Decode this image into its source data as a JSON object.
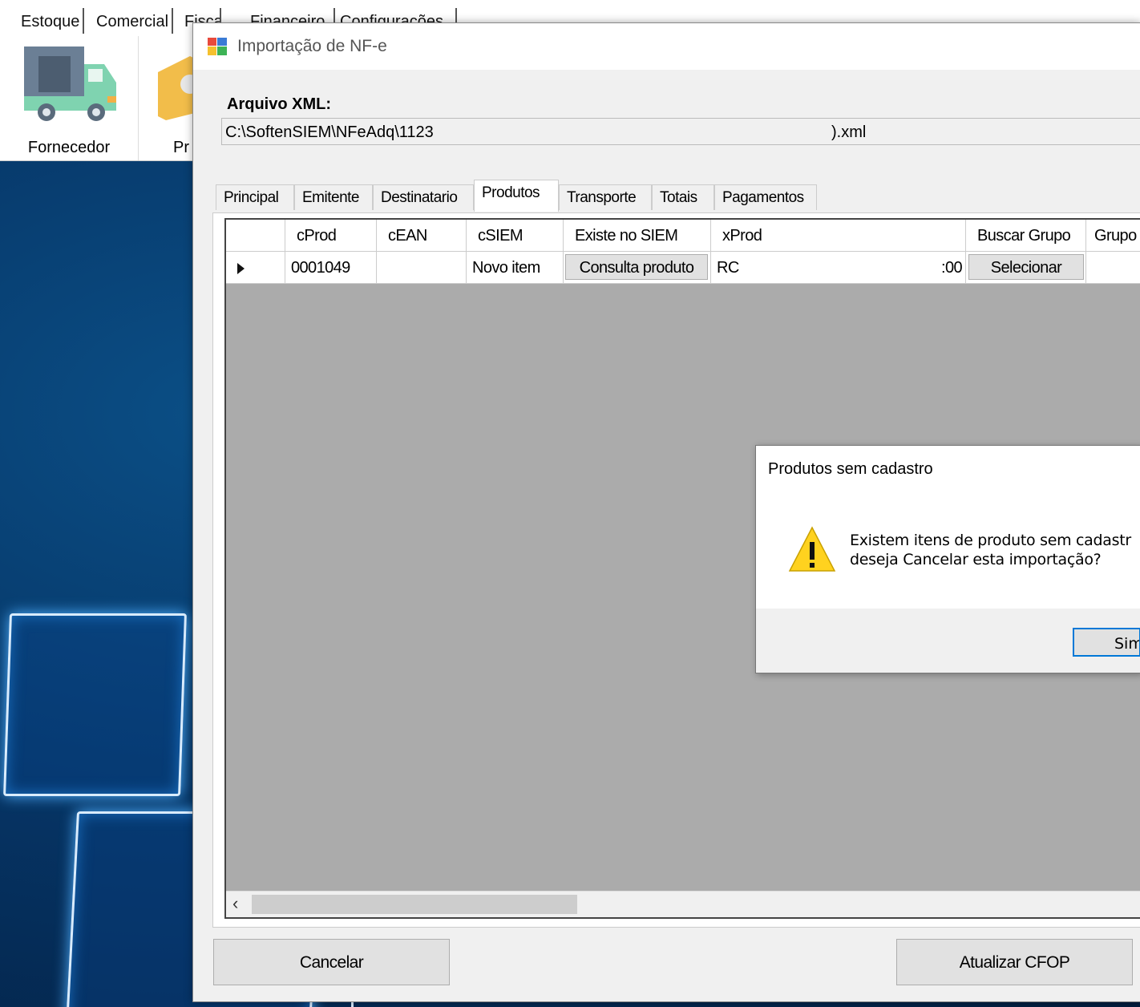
{
  "menubar": {
    "tabs": [
      "Estoque",
      "Comercial",
      "Fiscal",
      "Financeiro",
      "Configurações"
    ]
  },
  "ribbon": {
    "items": [
      {
        "label": "Fornecedor",
        "icon": "truck-icon"
      },
      {
        "label": "Pr",
        "icon": "box-icon"
      }
    ]
  },
  "window": {
    "title": "Importação de NF-e",
    "icon": "app-icon"
  },
  "xml": {
    "label": "Arquivo XML:",
    "path": "C:\\SoftenSIEM\\NFeAdq\\1123",
    "suffix": ").xml"
  },
  "tabs": [
    "Principal",
    "Emitente",
    "Destinatario",
    "Produtos",
    "Transporte",
    "Totais",
    "Pagamentos"
  ],
  "active_tab": "Produtos",
  "grid": {
    "columns": [
      "",
      "cProd",
      "cEAN",
      "cSIEM",
      "Existe no SIEM",
      "xProd",
      "Buscar Grupo",
      "Grupo"
    ],
    "rows": [
      {
        "cProd": "0001049",
        "cEAN": "",
        "cSIEM": "Novo item",
        "existe_btn": "Consulta produto",
        "xProd": "RC",
        "xProd_tail": ":00",
        "buscar_btn": "Selecionar",
        "grupo": ""
      }
    ]
  },
  "buttons": {
    "cancel": "Cancelar",
    "update_cfop": "Atualizar CFOP"
  },
  "messagebox": {
    "title": "Produtos sem cadastro",
    "line1": "Existem itens de produto sem cadastr",
    "line2": "deseja Cancelar esta importação?",
    "yes": "Sim",
    "icon": "warning-icon"
  }
}
